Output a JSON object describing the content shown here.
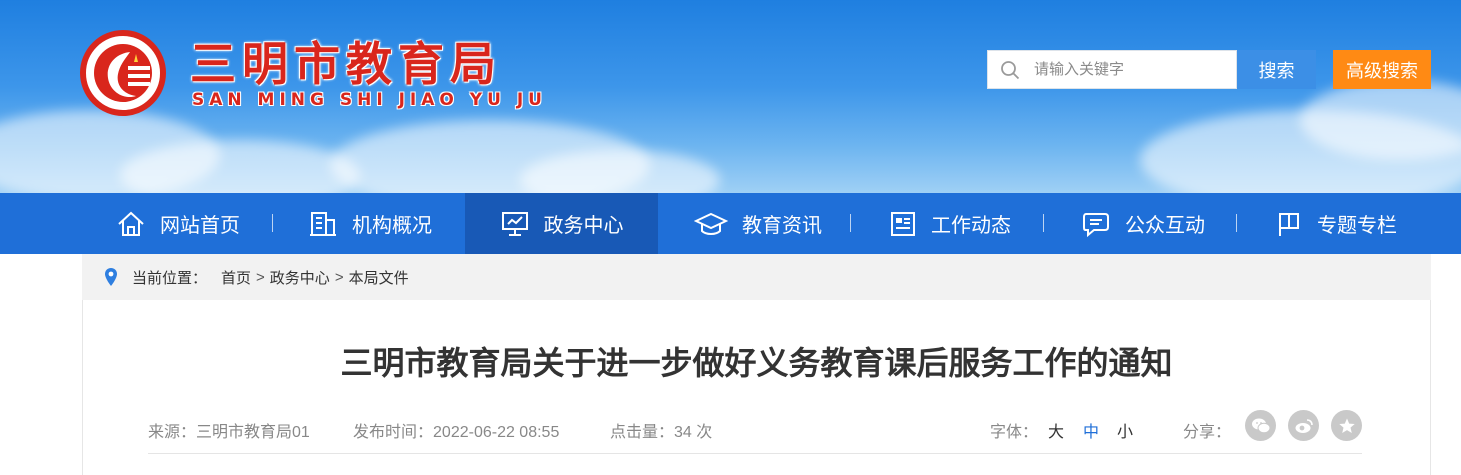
{
  "header": {
    "title": "三明市教育局",
    "subtitle": "SAN MING SHI JIAO YU JU",
    "search": {
      "placeholder": "请输入关键字",
      "search_label": "搜索",
      "advanced_label": "高级搜索"
    }
  },
  "nav": {
    "items": [
      {
        "label": "网站首页",
        "icon": "home-icon"
      },
      {
        "label": "机构概况",
        "icon": "building-icon"
      },
      {
        "label": "政务中心",
        "icon": "presentation-icon",
        "active": true
      },
      {
        "label": "教育资讯",
        "icon": "graduation-cap-icon"
      },
      {
        "label": "工作动态",
        "icon": "news-icon"
      },
      {
        "label": "公众互动",
        "icon": "chat-icon"
      },
      {
        "label": "专题专栏",
        "icon": "flag-icon"
      }
    ]
  },
  "breadcrumb": {
    "prefix": "当前位置：",
    "items": [
      "首页",
      "政务中心",
      "本局文件"
    ],
    "separator": ">"
  },
  "article": {
    "title": "三明市教育局关于进一步做好义务教育课后服务工作的通知",
    "source_label": "来源：",
    "source": "三明市教育局01",
    "date_label": "发布时间：",
    "date": "2022-06-22 08:55",
    "hits_label": "点击量：",
    "hits": "34 次",
    "font_label": "字体：",
    "font_large": "大",
    "font_medium": "中",
    "font_small": "小",
    "share_label": "分享：",
    "share_icons": [
      "wechat-icon",
      "weibo-icon",
      "favorite-icon"
    ]
  },
  "colors": {
    "brand_red": "#d9261c",
    "nav_blue": "#1f6fd8",
    "nav_active": "#1859b6",
    "search_blue": "#3c8fe6",
    "advanced_orange": "#ff8a14",
    "active_font": "#1f6fd8"
  }
}
